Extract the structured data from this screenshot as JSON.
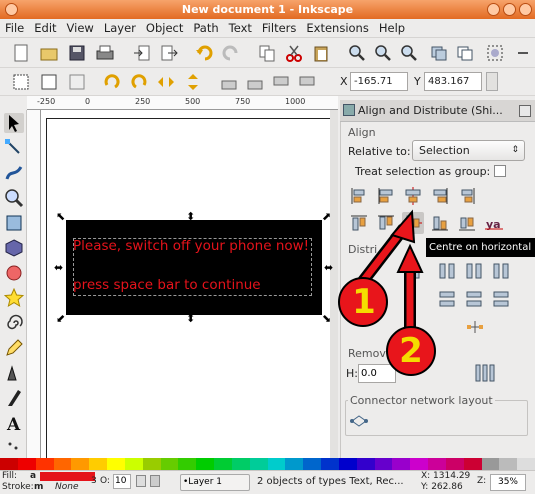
{
  "window": {
    "title": "New document 1 - Inkscape"
  },
  "menu": [
    "File",
    "Edit",
    "View",
    "Layer",
    "Object",
    "Path",
    "Text",
    "Filters",
    "Extensions",
    "Help"
  ],
  "controls": {
    "x_label": "X",
    "x_value": "-165.71",
    "y_label": "Y",
    "y_value": "483.167"
  },
  "ruler": {
    "ticks": [
      "-250",
      "0",
      "250",
      "500",
      "750",
      "1000"
    ]
  },
  "canvas": {
    "line1": "Please, switch off your phone now!",
    "line2": "press space bar to continue"
  },
  "annotations": {
    "one": "1",
    "two": "2"
  },
  "panel": {
    "title": "Align and Distribute (Shi...",
    "align_section": "Align",
    "relative_label": "Relative to:",
    "relative_value": "Selection",
    "group_label": "Treat selection as group:",
    "distribute_section": "Distri",
    "remove_section": "Remov",
    "h_label": "H:",
    "h_value": "0.0",
    "connector_section": "Connector network layout",
    "tooltip": "Centre on horizontal"
  },
  "palette": [
    "#c00",
    "#e00",
    "#f30",
    "#f60",
    "#f90",
    "#fc0",
    "#ff0",
    "#cf0",
    "#9c0",
    "#6c0",
    "#3c0",
    "#0c0",
    "#0c3",
    "#0c6",
    "#0c9",
    "#0cc",
    "#09c",
    "#06c",
    "#03c",
    "#00c",
    "#30c",
    "#60c",
    "#90c",
    "#c0c",
    "#c09",
    "#c06",
    "#c03",
    "#999",
    "#bbb",
    "#ddd"
  ],
  "status": {
    "fill_label": "Fill:",
    "fill_value": "a",
    "stroke_label": "Stroke:",
    "stroke_value": "m",
    "stroke_style": "None",
    "stroke_width": "3",
    "opacity_label": "O:",
    "opacity_value": "10",
    "layer": "•Layer 1",
    "message": "2 objects of types Text, Rec...",
    "x_readout": "X: 1314.29",
    "y_readout": "Y: 262.86",
    "zoom_label": "Z:",
    "zoom_value": "35%"
  }
}
